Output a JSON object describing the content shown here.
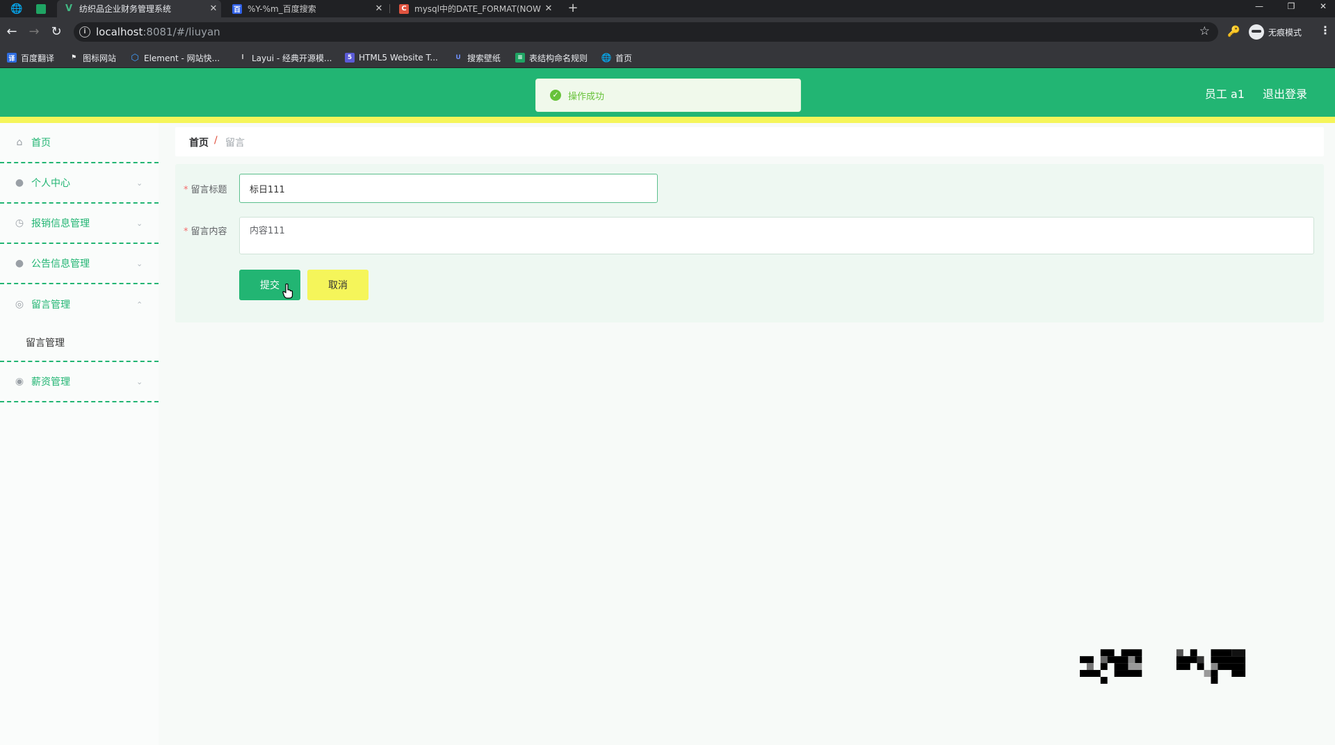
{
  "browser": {
    "tabs": [
      {
        "title": "纺织品企业财务管理系统",
        "active": true,
        "favicon_color": "#42b883"
      },
      {
        "title": "%Y-%m_百度搜索",
        "active": false,
        "favicon_color": "#3061e8"
      },
      {
        "title": "mysql中的DATE_FORMAT(NOW",
        "active": false,
        "favicon_color": "#e0533f"
      }
    ],
    "address": {
      "host": "localhost",
      "rest": ":8081/#/liuyan"
    },
    "profile_label": "无痕模式",
    "bookmarks": [
      {
        "label": "百度翻译",
        "icon": "translate-icon",
        "color": "#2f6de1"
      },
      {
        "label": "图标网站",
        "icon": "flag-icon",
        "color": "#ffffff"
      },
      {
        "label": "Element - 网站快...",
        "icon": "element-icon",
        "color": "#409eff"
      },
      {
        "label": "Layui - 经典开源模...",
        "icon": "layui-icon",
        "color": "#cccccc"
      },
      {
        "label": "HTML5 Website T...",
        "icon": "html5-icon",
        "color": "#5b5bd6"
      },
      {
        "label": "搜索壁纸",
        "icon": "wallpaper-icon",
        "color": "#3c6cd8"
      },
      {
        "label": "表结构命名规则",
        "icon": "doc-icon",
        "color": "#1fa463"
      },
      {
        "label": "首页",
        "icon": "globe-icon",
        "color": "#dddddd"
      }
    ]
  },
  "header": {
    "user_label": "员工 a1",
    "logout_label": "退出登录",
    "brand_color": "#22b573",
    "accent_color": "#f5f55a"
  },
  "toast": {
    "message": "操作成功"
  },
  "sidebar": {
    "items": [
      {
        "label": "首页",
        "icon": "home-icon"
      },
      {
        "label": "个人中心",
        "icon": "user-icon"
      },
      {
        "label": "报销信息管理",
        "icon": "clock-icon"
      },
      {
        "label": "公告信息管理",
        "icon": "user-icon"
      },
      {
        "label": "留言管理",
        "icon": "globe-icon",
        "expanded": true,
        "sub": "留言管理"
      },
      {
        "label": "薪资管理",
        "icon": "location-icon"
      }
    ]
  },
  "breadcrumb": {
    "home": "首页",
    "separator": "/",
    "current": "留言"
  },
  "form": {
    "title_label": "留言标题",
    "title_value": "标日111",
    "content_label": "留言内容",
    "content_value": "内容111",
    "submit_label": "提交",
    "cancel_label": "取消"
  }
}
